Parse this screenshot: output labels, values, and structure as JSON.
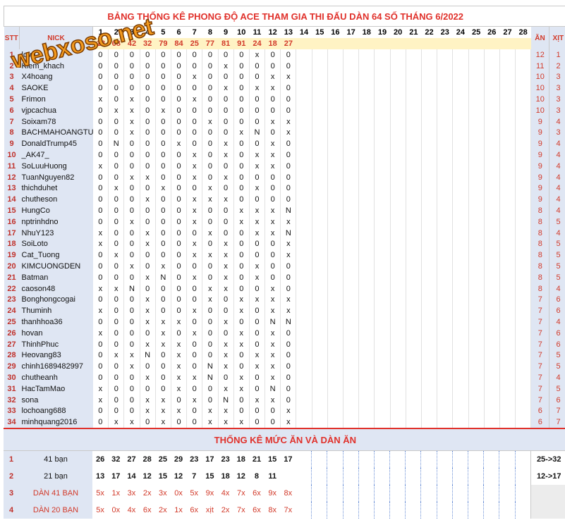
{
  "title": "BẢNG THỐNG KÊ PHONG ĐỘ ACE THAM GIA THI ĐẤU DÀN 64 SỐ THÁNG 6/2022",
  "logo_text": "webxoso.net",
  "headers": {
    "stt": "STT",
    "nick": "NICK",
    "an": "ĂN",
    "xit": "XỊT"
  },
  "days": [
    "1",
    "2",
    "3",
    "4",
    "5",
    "6",
    "7",
    "8",
    "9",
    "10",
    "11",
    "12",
    "13",
    "14",
    "15",
    "16",
    "17",
    "18",
    "19",
    "20",
    "21",
    "22",
    "23",
    "24",
    "25",
    "26",
    "27",
    "28"
  ],
  "day_numbers": [
    "18",
    "68",
    "42",
    "32",
    "79",
    "84",
    "25",
    "77",
    "81",
    "91",
    "24",
    "18",
    "27"
  ],
  "rows": [
    {
      "stt": "1",
      "nick": "love",
      "cells": [
        "0",
        "0",
        "0",
        "0",
        "0",
        "0",
        "0",
        "0",
        "0",
        "0",
        "x",
        "0",
        "0"
      ],
      "an": "12",
      "xit": "1"
    },
    {
      "stt": "2",
      "nick": "Kiem_khach",
      "cells": [
        "0",
        "0",
        "0",
        "0",
        "0",
        "0",
        "0",
        "0",
        "x",
        "0",
        "0",
        "0",
        "0"
      ],
      "an": "11",
      "xit": "2"
    },
    {
      "stt": "3",
      "nick": "X4hoang",
      "cells": [
        "0",
        "0",
        "0",
        "0",
        "0",
        "0",
        "x",
        "0",
        "0",
        "0",
        "0",
        "x",
        "x"
      ],
      "an": "10",
      "xit": "3"
    },
    {
      "stt": "4",
      "nick": "SAOKE",
      "cells": [
        "0",
        "0",
        "0",
        "0",
        "0",
        "0",
        "0",
        "0",
        "x",
        "0",
        "x",
        "x",
        "0"
      ],
      "an": "10",
      "xit": "3"
    },
    {
      "stt": "5",
      "nick": "Frimon",
      "cells": [
        "x",
        "0",
        "x",
        "0",
        "0",
        "0",
        "x",
        "0",
        "0",
        "0",
        "0",
        "0",
        "0"
      ],
      "an": "10",
      "xit": "3"
    },
    {
      "stt": "6",
      "nick": "vjpcachua",
      "cells": [
        "0",
        "x",
        "x",
        "0",
        "x",
        "0",
        "0",
        "0",
        "0",
        "0",
        "0",
        "0",
        "0"
      ],
      "an": "10",
      "xit": "3"
    },
    {
      "stt": "7",
      "nick": "Soixam78",
      "cells": [
        "0",
        "0",
        "x",
        "0",
        "0",
        "0",
        "0",
        "x",
        "0",
        "0",
        "0",
        "x",
        "x"
      ],
      "an": "9",
      "xit": "4"
    },
    {
      "stt": "8",
      "nick": "BACHMAHOANGTU",
      "cells": [
        "0",
        "0",
        "x",
        "0",
        "0",
        "0",
        "0",
        "0",
        "0",
        "x",
        "N",
        "0",
        "x"
      ],
      "an": "9",
      "xit": "3"
    },
    {
      "stt": "9",
      "nick": "DonaldTrump45",
      "cells": [
        "0",
        "N",
        "0",
        "0",
        "0",
        "x",
        "0",
        "0",
        "x",
        "0",
        "0",
        "x",
        "0"
      ],
      "an": "9",
      "xit": "4"
    },
    {
      "stt": "10",
      "nick": "_AK47_",
      "cells": [
        "0",
        "0",
        "0",
        "0",
        "0",
        "0",
        "x",
        "0",
        "x",
        "0",
        "x",
        "x",
        "0"
      ],
      "an": "9",
      "xit": "4"
    },
    {
      "stt": "11",
      "nick": "SoLuuHuong",
      "cells": [
        "x",
        "0",
        "0",
        "0",
        "0",
        "0",
        "x",
        "0",
        "0",
        "0",
        "x",
        "x",
        "0"
      ],
      "an": "9",
      "xit": "4"
    },
    {
      "stt": "12",
      "nick": "TuanNguyen82",
      "cells": [
        "0",
        "0",
        "x",
        "x",
        "0",
        "0",
        "x",
        "0",
        "x",
        "0",
        "0",
        "0",
        "0"
      ],
      "an": "9",
      "xit": "4"
    },
    {
      "stt": "13",
      "nick": "thichduhet",
      "cells": [
        "0",
        "x",
        "0",
        "0",
        "x",
        "0",
        "0",
        "x",
        "0",
        "0",
        "x",
        "0",
        "0"
      ],
      "an": "9",
      "xit": "4"
    },
    {
      "stt": "14",
      "nick": "chutheson",
      "cells": [
        "0",
        "0",
        "0",
        "x",
        "0",
        "0",
        "x",
        "x",
        "x",
        "0",
        "0",
        "0",
        "0"
      ],
      "an": "9",
      "xit": "4"
    },
    {
      "stt": "15",
      "nick": "HungCo",
      "cells": [
        "0",
        "0",
        "0",
        "0",
        "0",
        "0",
        "x",
        "0",
        "0",
        "x",
        "x",
        "x",
        "N"
      ],
      "an": "8",
      "xit": "4"
    },
    {
      "stt": "16",
      "nick": "nptrinhdno",
      "cells": [
        "0",
        "0",
        "x",
        "0",
        "0",
        "0",
        "x",
        "0",
        "0",
        "x",
        "x",
        "x",
        "x"
      ],
      "an": "8",
      "xit": "5"
    },
    {
      "stt": "17",
      "nick": "NhuY123",
      "cells": [
        "x",
        "0",
        "0",
        "x",
        "0",
        "0",
        "0",
        "x",
        "0",
        "0",
        "x",
        "x",
        "N"
      ],
      "an": "8",
      "xit": "4"
    },
    {
      "stt": "18",
      "nick": "SoiLoto",
      "cells": [
        "x",
        "0",
        "0",
        "x",
        "0",
        "0",
        "x",
        "0",
        "x",
        "0",
        "0",
        "0",
        "x"
      ],
      "an": "8",
      "xit": "5"
    },
    {
      "stt": "19",
      "nick": "Cat_Tuong",
      "cells": [
        "0",
        "x",
        "0",
        "0",
        "0",
        "0",
        "x",
        "x",
        "x",
        "0",
        "0",
        "0",
        "x"
      ],
      "an": "8",
      "xit": "5"
    },
    {
      "stt": "20",
      "nick": "KIMCUONGDEN",
      "cells": [
        "0",
        "0",
        "x",
        "0",
        "x",
        "0",
        "0",
        "0",
        "x",
        "0",
        "x",
        "0",
        "0"
      ],
      "an": "8",
      "xit": "5"
    },
    {
      "stt": "21",
      "nick": "Batman",
      "cells": [
        "0",
        "0",
        "0",
        "x",
        "N",
        "0",
        "x",
        "0",
        "x",
        "0",
        "x",
        "0",
        "0"
      ],
      "an": "8",
      "xit": "5"
    },
    {
      "stt": "22",
      "nick": "caoson48",
      "cells": [
        "x",
        "x",
        "N",
        "0",
        "0",
        "0",
        "0",
        "x",
        "x",
        "0",
        "0",
        "x",
        "0"
      ],
      "an": "8",
      "xit": "4"
    },
    {
      "stt": "23",
      "nick": "Bonghongcogai",
      "cells": [
        "0",
        "0",
        "0",
        "x",
        "0",
        "0",
        "0",
        "x",
        "0",
        "x",
        "x",
        "x",
        "x"
      ],
      "an": "7",
      "xit": "6"
    },
    {
      "stt": "24",
      "nick": "Thuminh",
      "cells": [
        "x",
        "0",
        "0",
        "x",
        "0",
        "0",
        "x",
        "0",
        "0",
        "x",
        "0",
        "x",
        "x"
      ],
      "an": "7",
      "xit": "6"
    },
    {
      "stt": "25",
      "nick": "thanhhoa36",
      "cells": [
        "0",
        "0",
        "0",
        "x",
        "x",
        "x",
        "0",
        "0",
        "x",
        "0",
        "0",
        "N",
        "N"
      ],
      "an": "7",
      "xit": "4"
    },
    {
      "stt": "26",
      "nick": "hovan",
      "cells": [
        "x",
        "0",
        "0",
        "0",
        "x",
        "0",
        "x",
        "0",
        "0",
        "x",
        "0",
        "x",
        "0"
      ],
      "an": "7",
      "xit": "6"
    },
    {
      "stt": "27",
      "nick": "ThinhPhuc",
      "cells": [
        "0",
        "0",
        "0",
        "x",
        "x",
        "x",
        "0",
        "0",
        "x",
        "x",
        "0",
        "x",
        "0"
      ],
      "an": "7",
      "xit": "6"
    },
    {
      "stt": "28",
      "nick": "Heovang83",
      "cells": [
        "0",
        "x",
        "x",
        "N",
        "0",
        "x",
        "0",
        "0",
        "x",
        "0",
        "x",
        "x",
        "0"
      ],
      "an": "7",
      "xit": "5"
    },
    {
      "stt": "29",
      "nick": "chinh1689482997",
      "cells": [
        "0",
        "0",
        "x",
        "0",
        "0",
        "x",
        "0",
        "N",
        "x",
        "0",
        "x",
        "x",
        "0"
      ],
      "an": "7",
      "xit": "5"
    },
    {
      "stt": "30",
      "nick": "chutheanh",
      "cells": [
        "0",
        "0",
        "0",
        "x",
        "0",
        "x",
        "x",
        "N",
        "0",
        "x",
        "0",
        "x",
        "0"
      ],
      "an": "7",
      "xit": "4"
    },
    {
      "stt": "31",
      "nick": "HacTamMao",
      "cells": [
        "x",
        "0",
        "0",
        "0",
        "0",
        "x",
        "0",
        "0",
        "x",
        "x",
        "0",
        "N",
        "0"
      ],
      "an": "7",
      "xit": "5"
    },
    {
      "stt": "32",
      "nick": "sona",
      "cells": [
        "x",
        "0",
        "0",
        "x",
        "x",
        "0",
        "x",
        "0",
        "N",
        "0",
        "x",
        "x",
        "0"
      ],
      "an": "7",
      "xit": "6"
    },
    {
      "stt": "33",
      "nick": "lochoang688",
      "cells": [
        "0",
        "0",
        "0",
        "x",
        "x",
        "x",
        "0",
        "x",
        "x",
        "0",
        "0",
        "0",
        "x"
      ],
      "an": "6",
      "xit": "7"
    },
    {
      "stt": "34",
      "nick": "minhquang2016",
      "cells": [
        "0",
        "x",
        "x",
        "0",
        "x",
        "0",
        "0",
        "x",
        "x",
        "x",
        "0",
        "0",
        "x"
      ],
      "an": "6",
      "xit": "7"
    }
  ],
  "stats": {
    "title": "THỐNG KÊ MỨC ĂN VÀ DÀN ĂN",
    "rows": [
      {
        "stt": "1",
        "label": "41 bạn",
        "values": [
          "26",
          "32",
          "27",
          "28",
          "25",
          "29",
          "23",
          "17",
          "23",
          "18",
          "21",
          "15",
          "17"
        ],
        "right": "25->32"
      },
      {
        "stt": "2",
        "label": "21 bạn",
        "values": [
          "13",
          "17",
          "14",
          "12",
          "15",
          "12",
          "7",
          "15",
          "18",
          "12",
          "8",
          "11",
          ""
        ],
        "right": "12->17"
      },
      {
        "stt": "3",
        "label": "DÀN 41 BẠN",
        "values": [
          "5x",
          "1x",
          "3x",
          "2x",
          "3x",
          "0x",
          "5x",
          "9x",
          "4x",
          "7x",
          "6x",
          "9x",
          "8x"
        ],
        "right": ""
      },
      {
        "stt": "4",
        "label": "DÀN 20 BẠN",
        "values": [
          "5x",
          "0x",
          "4x",
          "6x",
          "2x",
          "1x",
          "6x",
          "xịt",
          "2x",
          "7x",
          "6x",
          "8x",
          "7x"
        ],
        "right": ""
      }
    ]
  },
  "colors": {
    "accent_red": "#e0312b",
    "side_blue": "#dfe6f3",
    "number_row_yellow": "#fff3c4"
  }
}
